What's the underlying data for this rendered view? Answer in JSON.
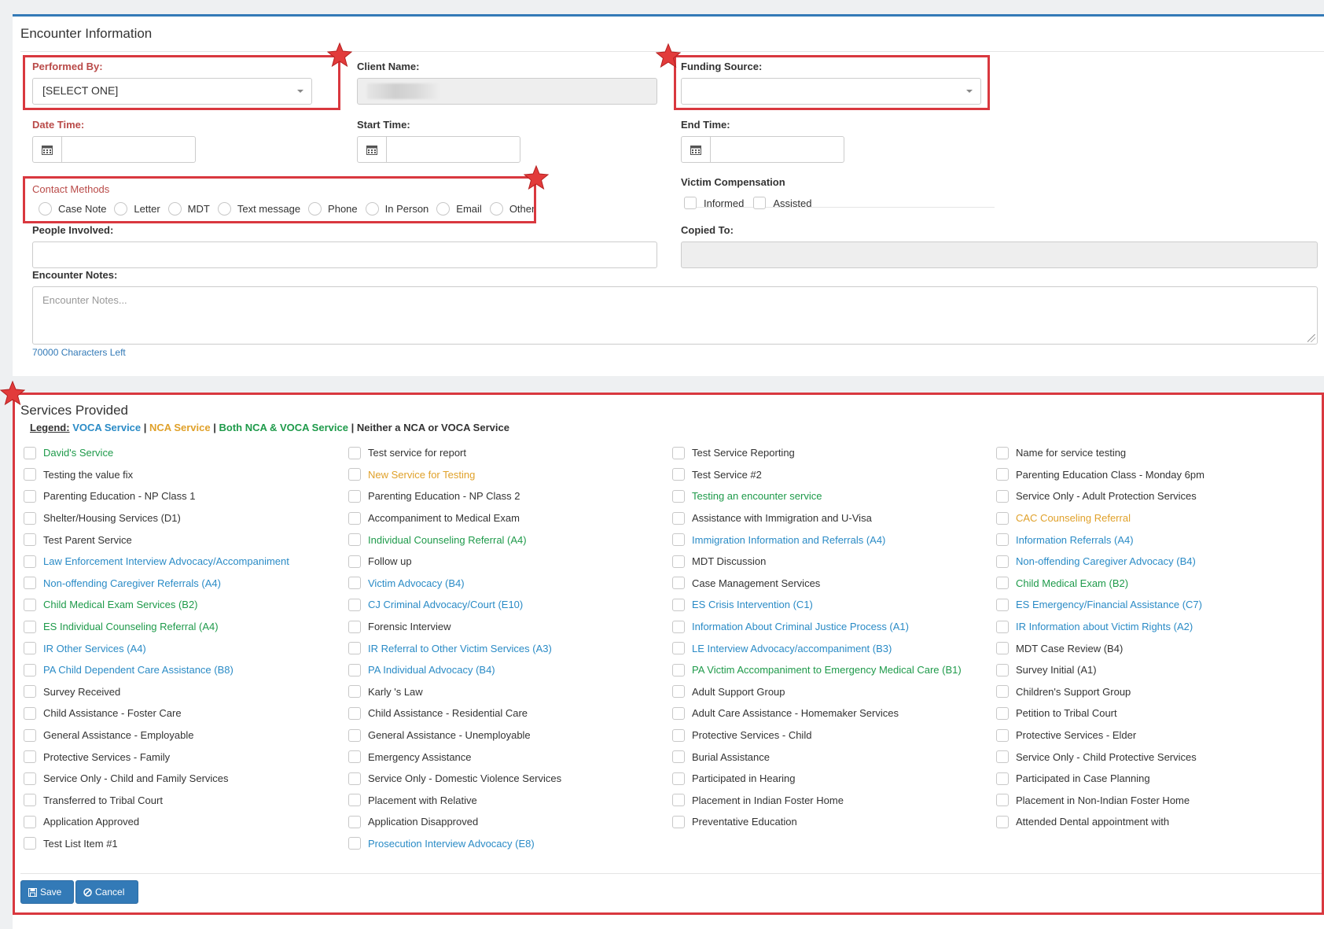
{
  "encounter": {
    "title": "Encounter Information",
    "performed_by": {
      "label": "Performed By:",
      "value": "[SELECT ONE]"
    },
    "client_name": {
      "label": "Client Name:"
    },
    "funding_source": {
      "label": "Funding Source:",
      "value": ""
    },
    "date_time": {
      "label": "Date Time:"
    },
    "start_time": {
      "label": "Start Time:"
    },
    "end_time": {
      "label": "End Time:"
    },
    "contact_methods": {
      "label": "Contact Methods",
      "options": [
        "Case Note",
        "Letter",
        "MDT",
        "Text message",
        "Phone",
        "In Person",
        "Email",
        "Other"
      ]
    },
    "victim_compensation": {
      "label": "Victim Compensation",
      "options": [
        "Informed",
        "Assisted"
      ]
    },
    "people_involved": {
      "label": "People Involved:"
    },
    "copied_to": {
      "label": "Copied To:"
    },
    "encounter_notes": {
      "label": "Encounter Notes:",
      "placeholder": "Encounter Notes..."
    },
    "chars_left": "70000 Characters Left"
  },
  "services": {
    "title": "Services Provided",
    "legend": {
      "label": "Legend:",
      "voca": "VOCA Service",
      "nca": "NCA Service",
      "both": "Both NCA & VOCA Service",
      "neither": "Neither a NCA or VOCA Service",
      "sep": "|"
    },
    "colors": {
      "voca": "#2a8bc6",
      "nca": "#e0a12a",
      "both": "#1e9a4a",
      "neither": "#333333"
    },
    "columns": [
      [
        {
          "label": "David's Service",
          "type": "both"
        },
        {
          "label": "Testing the value fix",
          "type": "neither"
        },
        {
          "label": "Parenting Education - NP Class 1",
          "type": "neither"
        },
        {
          "label": "Shelter/Housing Services (D1)",
          "type": "neither"
        },
        {
          "label": "Test Parent Service",
          "type": "neither"
        },
        {
          "label": "Law Enforcement Interview Advocacy/Accompaniment",
          "type": "voca"
        },
        {
          "label": "Non-offending Caregiver Referrals (A4)",
          "type": "voca"
        },
        {
          "label": "Child Medical Exam Services (B2)",
          "type": "both"
        },
        {
          "label": "ES Individual Counseling Referral (A4)",
          "type": "both"
        },
        {
          "label": "IR Other Services (A4)",
          "type": "voca"
        },
        {
          "label": "PA Child Dependent Care Assistance (B8)",
          "type": "voca"
        },
        {
          "label": "Survey Received",
          "type": "neither"
        },
        {
          "label": "Child Assistance - Foster Care",
          "type": "neither"
        },
        {
          "label": "General Assistance - Employable",
          "type": "neither"
        },
        {
          "label": "Protective Services - Family",
          "type": "neither"
        },
        {
          "label": "Service Only - Child and Family Services",
          "type": "neither"
        },
        {
          "label": "Transferred to Tribal Court",
          "type": "neither"
        },
        {
          "label": "Application Approved",
          "type": "neither"
        },
        {
          "label": "Test List Item #1",
          "type": "neither"
        }
      ],
      [
        {
          "label": "Test service for report",
          "type": "neither"
        },
        {
          "label": "New Service for Testing",
          "type": "nca"
        },
        {
          "label": "Parenting Education - NP Class 2",
          "type": "neither"
        },
        {
          "label": "Accompaniment to Medical Exam",
          "type": "neither"
        },
        {
          "label": "Individual Counseling Referral (A4)",
          "type": "both"
        },
        {
          "label": "Follow up",
          "type": "neither"
        },
        {
          "label": "Victim Advocacy (B4)",
          "type": "voca"
        },
        {
          "label": "CJ Criminal Advocacy/Court (E10)",
          "type": "voca"
        },
        {
          "label": "Forensic Interview",
          "type": "neither"
        },
        {
          "label": "IR Referral to Other Victim Services (A3)",
          "type": "voca"
        },
        {
          "label": "PA Individual Advocacy (B4)",
          "type": "voca"
        },
        {
          "label": "Karly 's Law",
          "type": "neither"
        },
        {
          "label": "Child Assistance - Residential Care",
          "type": "neither"
        },
        {
          "label": "General Assistance - Unemployable",
          "type": "neither"
        },
        {
          "label": "Emergency Assistance",
          "type": "neither"
        },
        {
          "label": "Service Only - Domestic Violence Services",
          "type": "neither"
        },
        {
          "label": "Placement with Relative",
          "type": "neither"
        },
        {
          "label": "Application Disapproved",
          "type": "neither"
        },
        {
          "label": "Prosecution Interview Advocacy (E8)",
          "type": "voca"
        }
      ],
      [
        {
          "label": "Test Service Reporting",
          "type": "neither"
        },
        {
          "label": "Test Service #2",
          "type": "neither"
        },
        {
          "label": "Testing an encounter service",
          "type": "both"
        },
        {
          "label": "Assistance with Immigration and U-Visa",
          "type": "neither"
        },
        {
          "label": "Immigration Information and Referrals (A4)",
          "type": "voca"
        },
        {
          "label": "MDT Discussion",
          "type": "neither"
        },
        {
          "label": "Case Management Services",
          "type": "neither"
        },
        {
          "label": "ES Crisis Intervention (C1)",
          "type": "voca"
        },
        {
          "label": "Information About Criminal Justice Process (A1)",
          "type": "voca"
        },
        {
          "label": "LE Interview Advocacy/accompaniment (B3)",
          "type": "voca"
        },
        {
          "label": "PA Victim Accompaniment to Emergency Medical Care (B1)",
          "type": "both"
        },
        {
          "label": "Adult Support Group",
          "type": "neither"
        },
        {
          "label": "Adult Care Assistance - Homemaker Services",
          "type": "neither"
        },
        {
          "label": "Protective Services - Child",
          "type": "neither"
        },
        {
          "label": "Burial Assistance",
          "type": "neither"
        },
        {
          "label": "Participated in Hearing",
          "type": "neither"
        },
        {
          "label": "Placement in Indian Foster Home",
          "type": "neither"
        },
        {
          "label": "Preventative Education",
          "type": "neither"
        }
      ],
      [
        {
          "label": "Name for service testing",
          "type": "neither"
        },
        {
          "label": "Parenting Education Class - Monday 6pm",
          "type": "neither"
        },
        {
          "label": "Service Only - Adult Protection Services",
          "type": "neither"
        },
        {
          "label": "CAC Counseling Referral",
          "type": "nca"
        },
        {
          "label": "Information Referrals (A4)",
          "type": "voca"
        },
        {
          "label": "Non-offending Caregiver Advocacy (B4)",
          "type": "voca"
        },
        {
          "label": "Child Medical Exam (B2)",
          "type": "both"
        },
        {
          "label": "ES Emergency/Financial Assistance (C7)",
          "type": "voca"
        },
        {
          "label": "IR Information about Victim Rights (A2)",
          "type": "voca"
        },
        {
          "label": "MDT Case Review (B4)",
          "type": "neither"
        },
        {
          "label": "Survey Initial (A1)",
          "type": "neither"
        },
        {
          "label": "Children's Support Group",
          "type": "neither"
        },
        {
          "label": "Petition to Tribal Court",
          "type": "neither"
        },
        {
          "label": "Protective Services - Elder",
          "type": "neither"
        },
        {
          "label": "Service Only - Child Protective Services",
          "type": "neither"
        },
        {
          "label": "Participated in Case Planning",
          "type": "neither"
        },
        {
          "label": "Placement in Non-Indian Foster Home",
          "type": "neither"
        },
        {
          "label": "Attended Dental appointment with",
          "type": "neither"
        }
      ]
    ]
  },
  "actions": {
    "save": "Save",
    "cancel": "Cancel"
  },
  "annotation_color": "#d9383f"
}
